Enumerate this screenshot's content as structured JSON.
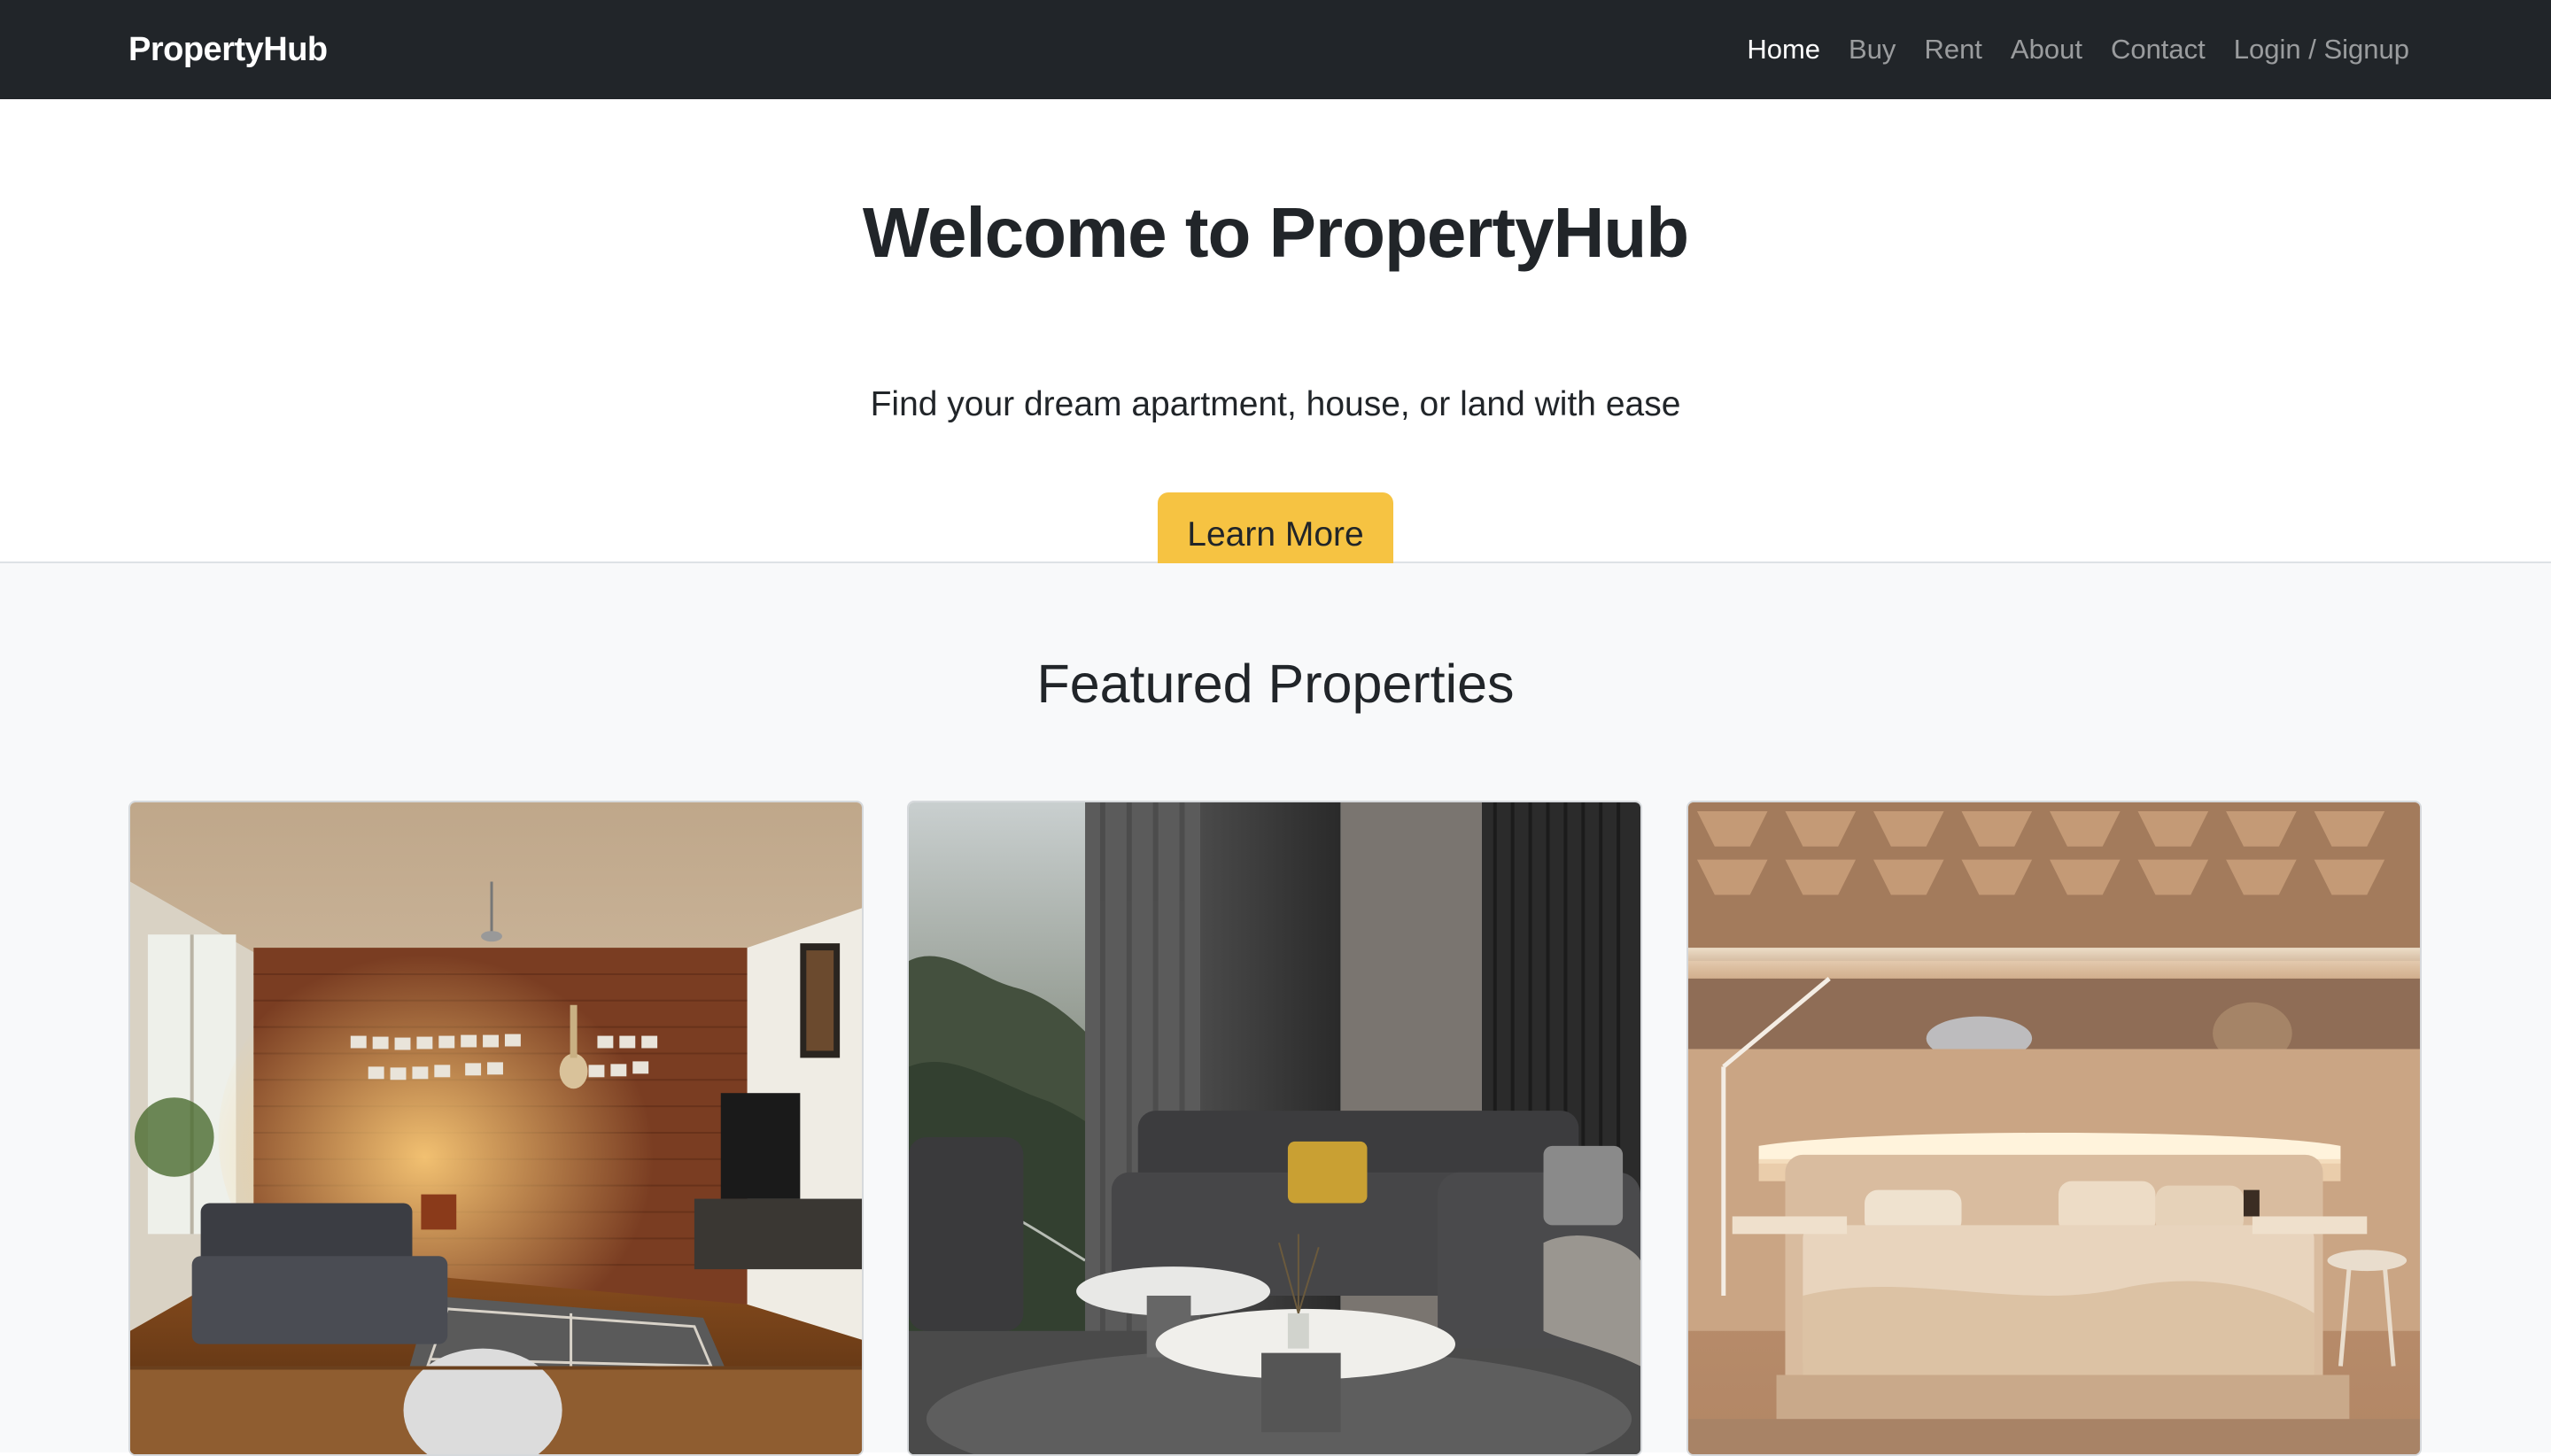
{
  "navbar": {
    "brand": "PropertyHub",
    "links": [
      {
        "label": "Home",
        "active": true
      },
      {
        "label": "Buy",
        "active": false
      },
      {
        "label": "Rent",
        "active": false
      },
      {
        "label": "About",
        "active": false
      },
      {
        "label": "Contact",
        "active": false
      },
      {
        "label": "Login / Signup",
        "active": false
      }
    ]
  },
  "hero": {
    "title": "Welcome to PropertyHub",
    "subtitle": "Find your dream apartment, house, or land with ease",
    "cta_label": "Learn More"
  },
  "featured": {
    "title": "Featured Properties",
    "cards": [
      {
        "image": "living-room-brick-wall-photo"
      },
      {
        "image": "dark-living-room-sofa-photo"
      },
      {
        "image": "warm-bedroom-photo"
      }
    ]
  },
  "colors": {
    "navbar_bg": "#212529",
    "accent": "#f6c342",
    "section_bg": "#f8f9fa"
  }
}
